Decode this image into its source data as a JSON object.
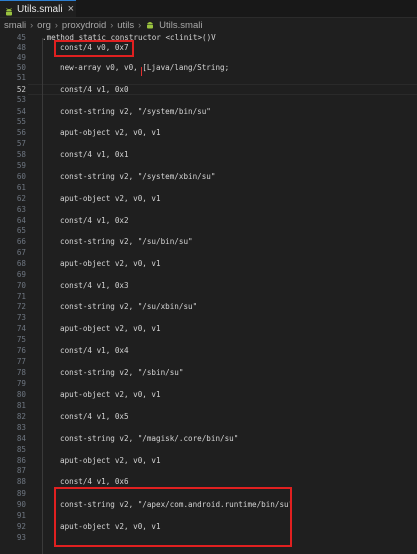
{
  "tab": {
    "label": "Utils.smali",
    "close": "×",
    "icon": "android-file-icon",
    "accent": "#2d7fd1"
  },
  "breadcrumb": [
    "smali",
    "org",
    "proxydroid",
    "utils",
    "Utils.smali"
  ],
  "breadcrumb_separator": "›",
  "editor": {
    "lines": [
      {
        "num": "45",
        "text": ".method static constructor <clinit>()V"
      },
      {
        "num": "48",
        "text": "const/4 v0, 0x7"
      },
      {
        "num": "49",
        "text": ""
      },
      {
        "num": "50",
        "text": "new-array v0, v0, [Ljava/lang/String;"
      },
      {
        "num": "51",
        "text": ""
      },
      {
        "num": "52",
        "text": "const/4 v1, 0x0"
      },
      {
        "num": "53",
        "text": ""
      },
      {
        "num": "54",
        "text": "const-string v2, \"/system/bin/su\""
      },
      {
        "num": "55",
        "text": ""
      },
      {
        "num": "56",
        "text": "aput-object v2, v0, v1"
      },
      {
        "num": "57",
        "text": ""
      },
      {
        "num": "58",
        "text": "const/4 v1, 0x1"
      },
      {
        "num": "59",
        "text": ""
      },
      {
        "num": "60",
        "text": "const-string v2, \"/system/xbin/su\""
      },
      {
        "num": "61",
        "text": ""
      },
      {
        "num": "62",
        "text": "aput-object v2, v0, v1"
      },
      {
        "num": "63",
        "text": ""
      },
      {
        "num": "64",
        "text": "const/4 v1, 0x2"
      },
      {
        "num": "65",
        "text": ""
      },
      {
        "num": "66",
        "text": "const-string v2, \"/su/bin/su\""
      },
      {
        "num": "67",
        "text": ""
      },
      {
        "num": "68",
        "text": "aput-object v2, v0, v1"
      },
      {
        "num": "69",
        "text": ""
      },
      {
        "num": "70",
        "text": "const/4 v1, 0x3"
      },
      {
        "num": "71",
        "text": ""
      },
      {
        "num": "72",
        "text": "const-string v2, \"/su/xbin/su\""
      },
      {
        "num": "73",
        "text": ""
      },
      {
        "num": "74",
        "text": "aput-object v2, v0, v1"
      },
      {
        "num": "75",
        "text": ""
      },
      {
        "num": "76",
        "text": "const/4 v1, 0x4"
      },
      {
        "num": "77",
        "text": ""
      },
      {
        "num": "78",
        "text": "const-string v2, \"/sbin/su\""
      },
      {
        "num": "79",
        "text": ""
      },
      {
        "num": "80",
        "text": "aput-object v2, v0, v1"
      },
      {
        "num": "81",
        "text": ""
      },
      {
        "num": "82",
        "text": "const/4 v1, 0x5"
      },
      {
        "num": "83",
        "text": ""
      },
      {
        "num": "84",
        "text": "const-string v2, \"/magisk/.core/bin/su\""
      },
      {
        "num": "85",
        "text": ""
      },
      {
        "num": "86",
        "text": "aput-object v2, v0, v1"
      },
      {
        "num": "87",
        "text": ""
      },
      {
        "num": "88",
        "text": "const/4 v1, 0x6"
      },
      {
        "num": "89",
        "text": ""
      },
      {
        "num": "90",
        "text": "const-string v2, \"/apex/com.android.runtime/bin/su\""
      },
      {
        "num": "91",
        "text": ""
      },
      {
        "num": "92",
        "text": "aput-object v2, v0, v1"
      },
      {
        "num": "93",
        "text": ""
      }
    ],
    "active_line": "52"
  },
  "colors": {
    "background": "#1f1f1f",
    "highlight": "#e02020"
  }
}
